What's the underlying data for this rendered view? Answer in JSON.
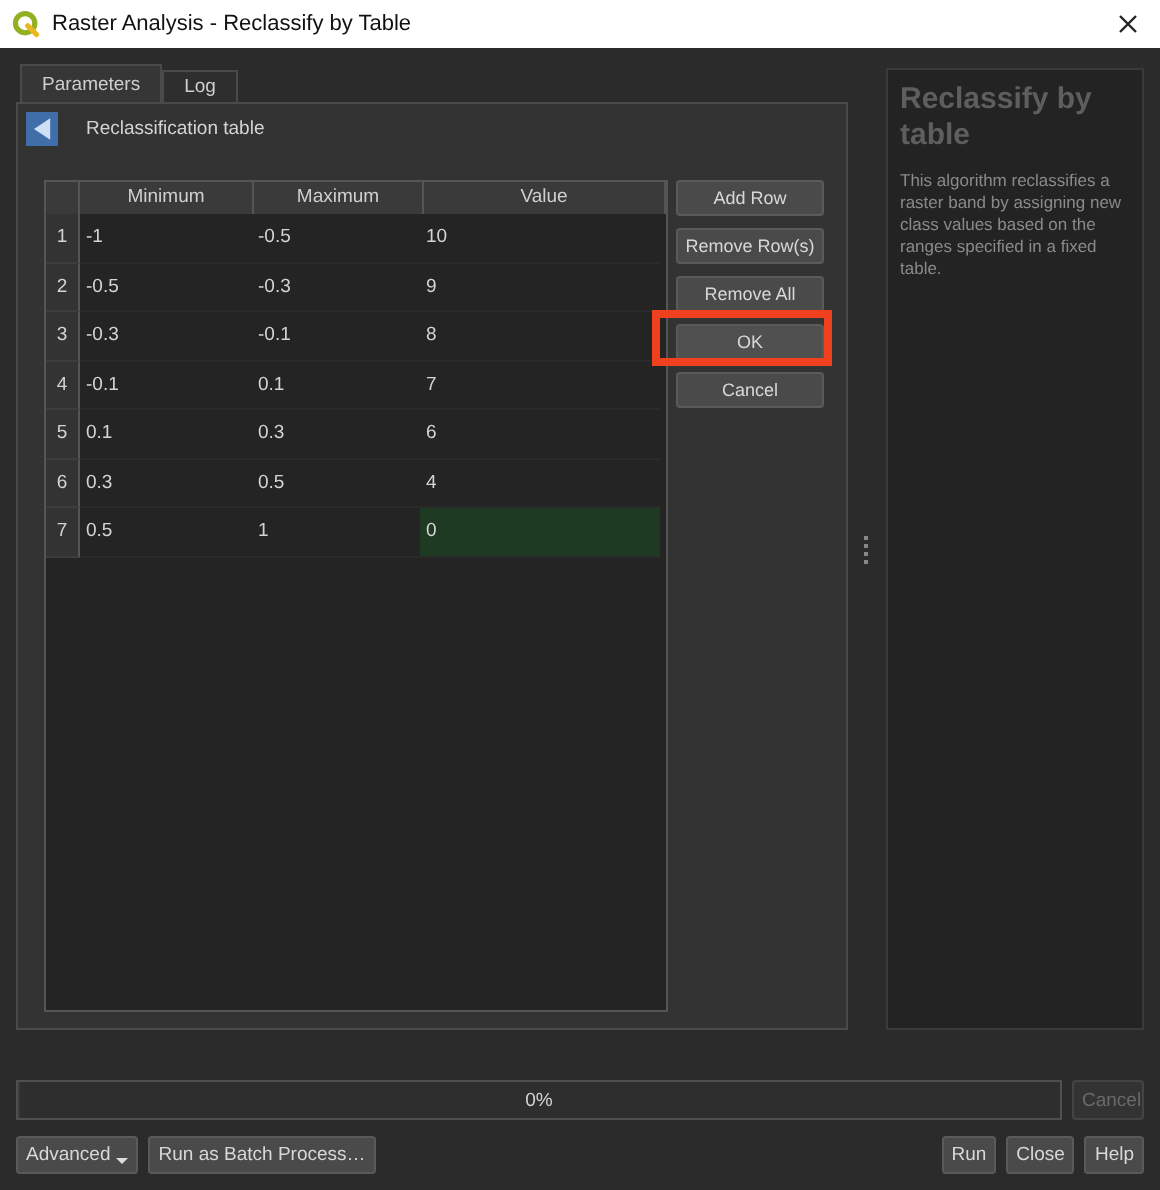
{
  "window": {
    "title": "Raster Analysis - Reclassify by Table"
  },
  "tabs": [
    {
      "label": "Parameters",
      "selected": true
    },
    {
      "label": "Log",
      "selected": false
    }
  ],
  "section": {
    "title": "Reclassification table"
  },
  "table": {
    "columns": [
      "Minimum",
      "Maximum",
      "Value"
    ],
    "rows": [
      {
        "number": "1",
        "cells": [
          "-1",
          "-0.5",
          "10"
        ],
        "selected": false
      },
      {
        "number": "2",
        "cells": [
          "-0.5",
          "-0.3",
          "9"
        ],
        "selected": false
      },
      {
        "number": "3",
        "cells": [
          "-0.3",
          "-0.1",
          "8"
        ],
        "selected": false
      },
      {
        "number": "4",
        "cells": [
          "-0.1",
          "0.1",
          "7"
        ],
        "selected": false
      },
      {
        "number": "5",
        "cells": [
          "0.1",
          "0.3",
          "6"
        ],
        "selected": false
      },
      {
        "number": "6",
        "cells": [
          "0.3",
          "0.5",
          "4"
        ],
        "selected": false
      },
      {
        "number": "7",
        "cells": [
          "0.5",
          "1",
          "0"
        ],
        "selected": true
      }
    ]
  },
  "table_buttons": [
    {
      "label": "Add Row",
      "highlighted": false
    },
    {
      "label": "Remove Row(s)",
      "highlighted": false
    },
    {
      "label": "Remove All",
      "highlighted": false
    },
    {
      "label": "OK",
      "highlighted": true
    },
    {
      "label": "Cancel",
      "highlighted": false
    }
  ],
  "help": {
    "title": "Reclassify by table",
    "text": "This algorithm reclassifies a raster band by assigning new class values based on the ranges specified in a fixed table."
  },
  "progress": {
    "label": "0%",
    "level": 0,
    "cancel": {
      "label": "Cancel",
      "disabled": true
    }
  },
  "footer": {
    "left": [
      "Advanced",
      "Run as Batch Process…"
    ],
    "right": [
      "Run",
      "Close",
      "Help"
    ]
  }
}
